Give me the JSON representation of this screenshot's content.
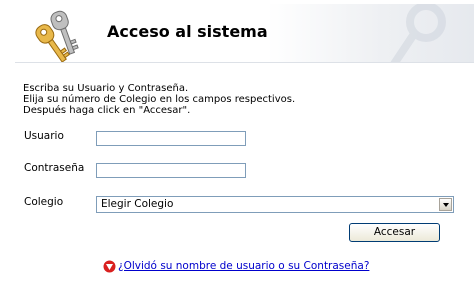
{
  "header": {
    "title": "Acceso al sistema",
    "icon": "keys-icon"
  },
  "instructions": [
    "Escriba su Usuario y Contraseña.",
    "Elija su número de Colegio en los campos respectivos.",
    "Después haga click en \"Accesar\"."
  ],
  "form": {
    "usuario_label": "Usuario",
    "usuario_value": "",
    "contrasena_label": "Contraseña",
    "contrasena_value": "",
    "colegio_label": "Colegio",
    "colegio_selected": "Elegir Colegio"
  },
  "buttons": {
    "submit_label": "Accesar"
  },
  "help": {
    "link_text": "¿Olvidó su nombre de usuario o su Contraseña?",
    "icon": "help-icon"
  },
  "colors": {
    "link": "#0000cc",
    "border": "#7f9db9",
    "button_border": "#003c74"
  }
}
